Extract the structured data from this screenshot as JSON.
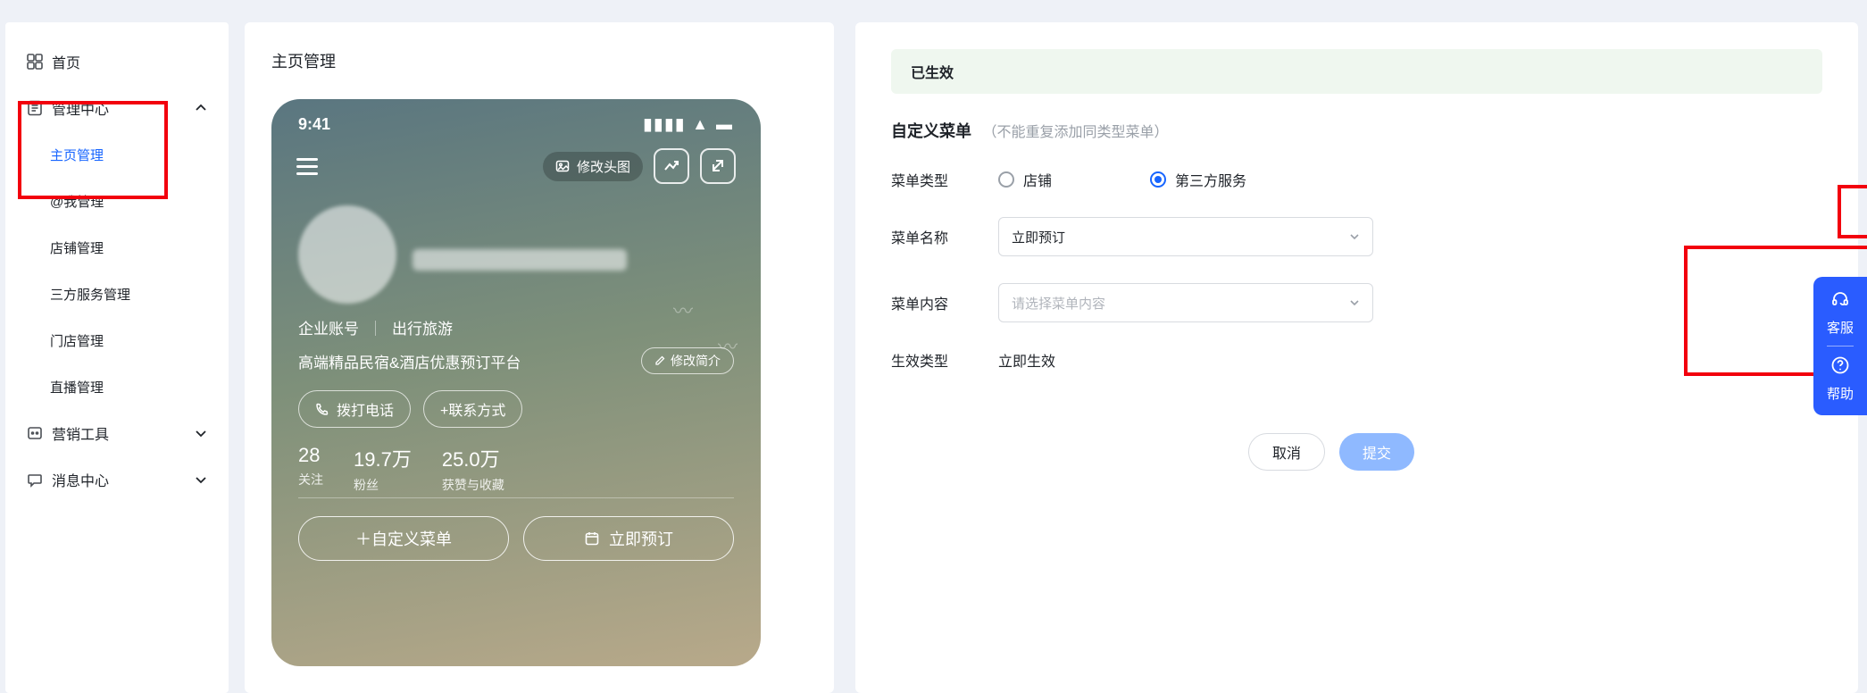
{
  "sidebar": {
    "home": "首页",
    "management_center": "管理中心",
    "children": {
      "homepage": "主页管理",
      "at_me": "@我管理",
      "shop": "店铺管理",
      "third": "三方服务管理",
      "store": "门店管理",
      "live": "直播管理"
    },
    "marketing": "营销工具",
    "message": "消息中心"
  },
  "page": {
    "title": "主页管理"
  },
  "phone": {
    "time": "9:41",
    "modify_header": "修改头图",
    "account_type": "企业账号",
    "category": "出行旅游",
    "tagline": "高端精品民宿&酒店优惠预订平台",
    "edit_intro": "修改简介",
    "call": "拨打电话",
    "contact": "+联系方式",
    "stats": {
      "follow_num": "28",
      "follow_lbl": "关注",
      "fans_num": "19.7万",
      "fans_lbl": "粉丝",
      "likes_num": "25.0万",
      "likes_lbl": "获赞与收藏"
    },
    "custom_menu": "＋自定义菜单",
    "book_now": "立即预订"
  },
  "right": {
    "banner": "已生效",
    "section_title": "自定义菜单",
    "section_sub": "（不能重复添加同类型菜单）",
    "labels": {
      "menu_type": "菜单类型",
      "menu_name": "菜单名称",
      "menu_content": "菜单内容",
      "effect_type": "生效类型"
    },
    "radio": {
      "shop": "店铺",
      "third": "第三方服务"
    },
    "menu_name_value": "立即预订",
    "menu_content_placeholder": "请选择菜单内容",
    "effect_value": "立即生效",
    "cancel": "取消",
    "submit": "提交"
  },
  "help": {
    "cs": "客服",
    "help": "帮助"
  }
}
